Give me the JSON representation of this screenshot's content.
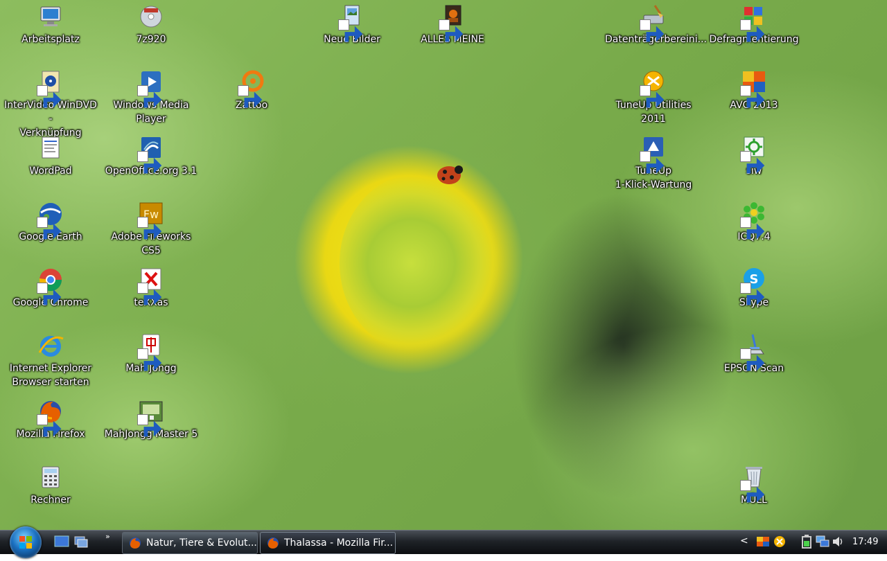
{
  "desktop": {
    "icons": [
      {
        "id": "arbeitsplatz",
        "label": "Arbeitsplatz",
        "icon": "computer-icon"
      },
      {
        "id": "7z920",
        "label": "7z920",
        "icon": "installer-disc-icon"
      },
      {
        "id": "neue-bilder",
        "label": "Neue Bilder",
        "icon": "pictures-folder-icon"
      },
      {
        "id": "alles-meine",
        "label": "ALLES MEINE",
        "icon": "photo-folder-icon"
      },
      {
        "id": "datentraeger",
        "label": "Datenträgerbereini...",
        "icon": "disk-cleanup-icon"
      },
      {
        "id": "defrag",
        "label": "Defragmentierung",
        "icon": "defragment-icon"
      },
      {
        "id": "windvd",
        "label": "InterVideo WinDVD -\nVerknüpfung",
        "icon": "dvd-player-icon"
      },
      {
        "id": "wmp",
        "label": "Windows Media\nPlayer",
        "icon": "media-player-icon"
      },
      {
        "id": "zattoo",
        "label": "Zattoo",
        "icon": "zattoo-icon"
      },
      {
        "id": "tuneup2011",
        "label": "TuneUp Utilities 2011",
        "icon": "tuneup-icon"
      },
      {
        "id": "avg",
        "label": "AVG 2013",
        "icon": "avg-antivirus-icon"
      },
      {
        "id": "wordpad",
        "label": "WordPad",
        "icon": "wordpad-icon"
      },
      {
        "id": "openoffice",
        "label": "OpenOffice.org 3.1",
        "icon": "openoffice-icon"
      },
      {
        "id": "tuneup1klick",
        "label": "TuneUp\n1-Klick-Wartung",
        "icon": "tuneup-maintenance-icon"
      },
      {
        "id": "siw",
        "label": "siw",
        "icon": "siw-icon"
      },
      {
        "id": "googleearth",
        "label": "Google Earth",
        "icon": "google-earth-icon"
      },
      {
        "id": "fireworks",
        "label": "Adobe Fireworks CS5",
        "icon": "fireworks-icon"
      },
      {
        "id": "icq",
        "label": "ICQ7.4",
        "icon": "icq-flower-icon"
      },
      {
        "id": "chrome",
        "label": "Google Chrome",
        "icon": "chrome-icon"
      },
      {
        "id": "texxas",
        "label": "teXXas",
        "icon": "texxas-icon"
      },
      {
        "id": "skype",
        "label": "Skype",
        "icon": "skype-icon"
      },
      {
        "id": "ie",
        "label": "Internet Explorer\nBrowser starten",
        "icon": "internet-explorer-icon"
      },
      {
        "id": "mahjongg",
        "label": "Mah Jongg",
        "icon": "mahjong-tile-icon"
      },
      {
        "id": "epson",
        "label": "EPSON Scan",
        "icon": "scanner-icon"
      },
      {
        "id": "firefox",
        "label": "Mozilla Firefox",
        "icon": "firefox-icon"
      },
      {
        "id": "mahjonggmaster",
        "label": "MahJongg Master 5",
        "icon": "mahjongg-master-icon"
      },
      {
        "id": "rechner",
        "label": "Rechner",
        "icon": "calculator-icon"
      },
      {
        "id": "muell",
        "label": "MÜLL",
        "icon": "recycle-bin-icon"
      }
    ]
  },
  "taskbar": {
    "start_icon": "windows-start-orb-icon",
    "quicklaunch": [
      {
        "icon": "show-desktop-icon"
      },
      {
        "icon": "switch-windows-icon"
      }
    ],
    "quicklaunch_more": "»",
    "tasks": [
      {
        "title": "Natur, Tiere & Evolut...",
        "icon": "firefox-icon",
        "active": false
      },
      {
        "title": "Thalassa - Mozilla Fir...",
        "icon": "firefox-icon",
        "active": true
      }
    ],
    "tray": {
      "chevron": "<",
      "clock": "17:49"
    }
  },
  "colors": {
    "taskbar_top": "#4a4f57",
    "taskbar_bottom": "#0b0d10",
    "label_text": "#ffffff",
    "sunflower": "#f4ea1a",
    "leaf": "#8dbd5e"
  }
}
